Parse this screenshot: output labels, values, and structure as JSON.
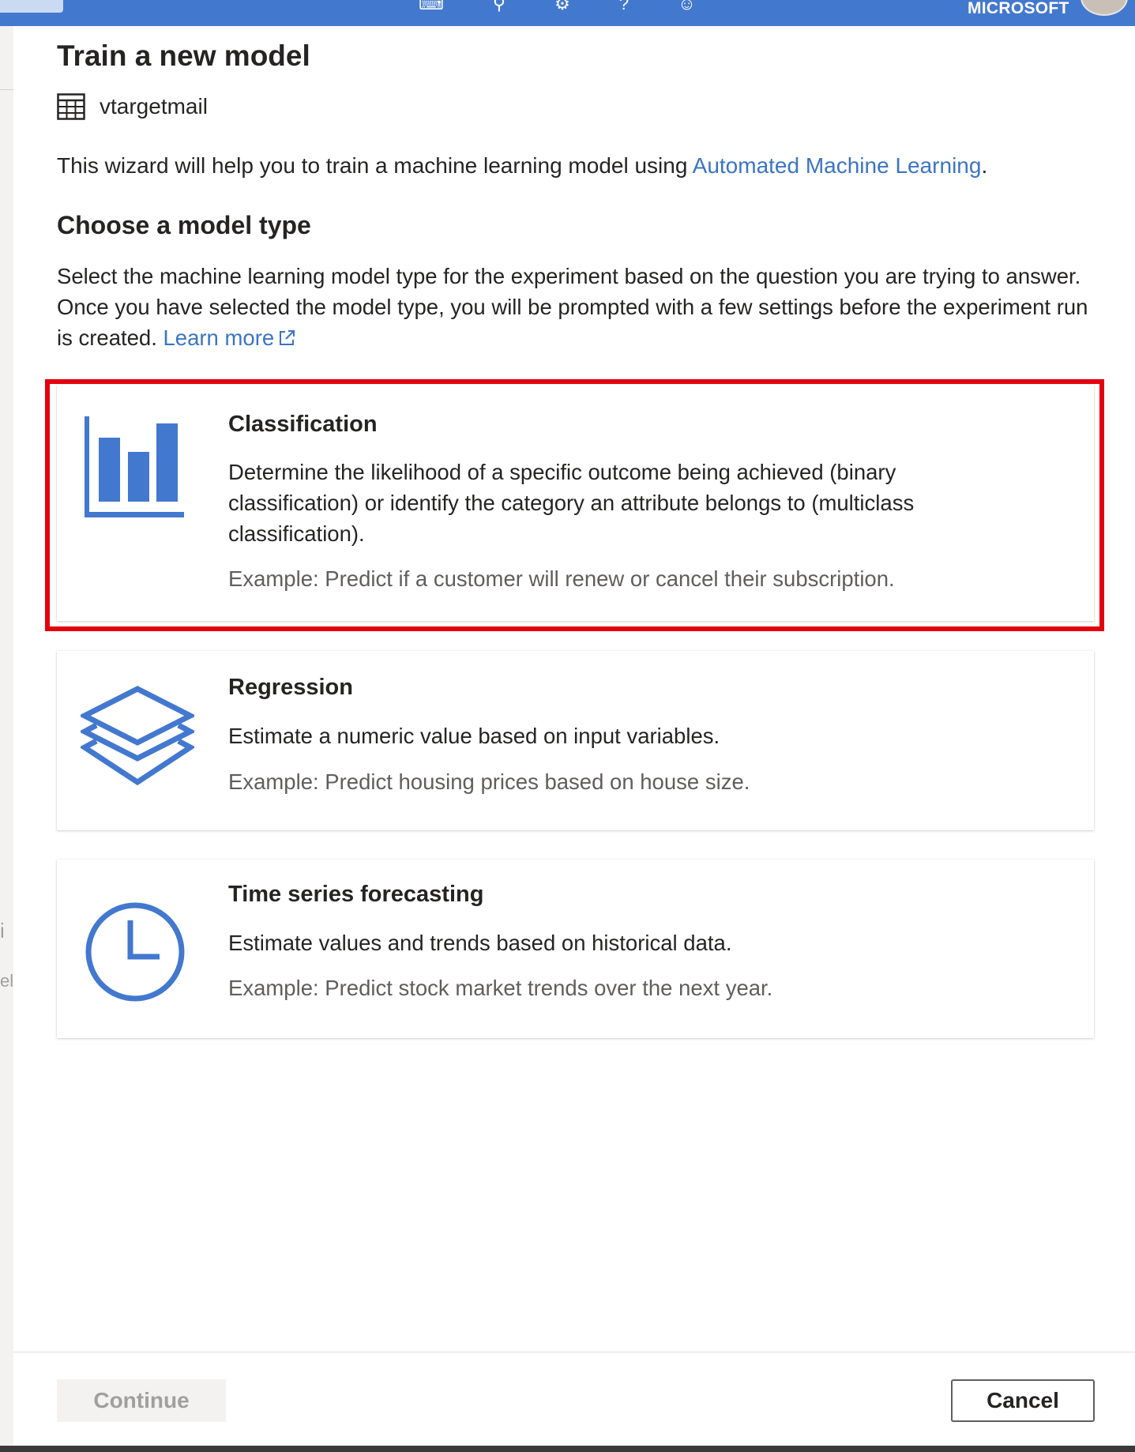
{
  "topbar": {
    "org_label": "MICROSOFT",
    "glyphs": "⌨ ⚲ ⚙ ? ☺"
  },
  "background": {
    "ghost_1": "i",
    "ghost_2": "el"
  },
  "panel": {
    "title": "Train a new model",
    "dataset_name": "vtargetmail",
    "intro_text": "This wizard will help you to train a machine learning model using ",
    "intro_link": "Automated Machine Learning",
    "intro_end": ".",
    "subtitle": "Choose a model type",
    "description": "Select the machine learning model type for the experiment based on the question you are trying to answer. Once you have selected the model type, you will be prompted with a few settings before the experiment run is created. ",
    "learn_more": "Learn more"
  },
  "model_types": [
    {
      "title": "Classification",
      "description": "Determine the likelihood of a specific outcome being achieved (binary classification) or identify the category an attribute belongs to (multiclass classification).",
      "example": "Example: Predict if a customer will renew or cancel their subscription.",
      "icon": "bar-chart-icon",
      "selected": true
    },
    {
      "title": "Regression",
      "description": "Estimate a numeric value based on input variables.",
      "example": "Example: Predict housing prices based on house size.",
      "icon": "layers-icon"
    },
    {
      "title": "Time series forecasting",
      "description": "Estimate values and trends based on historical data.",
      "example": "Example: Predict stock market trends over the next year.",
      "icon": "clock-icon"
    }
  ],
  "footer": {
    "continue_label": "Continue",
    "cancel_label": "Cancel"
  },
  "colors": {
    "accent": "#4378cf",
    "link": "#3b74c4",
    "highlight": "#e3000f"
  }
}
